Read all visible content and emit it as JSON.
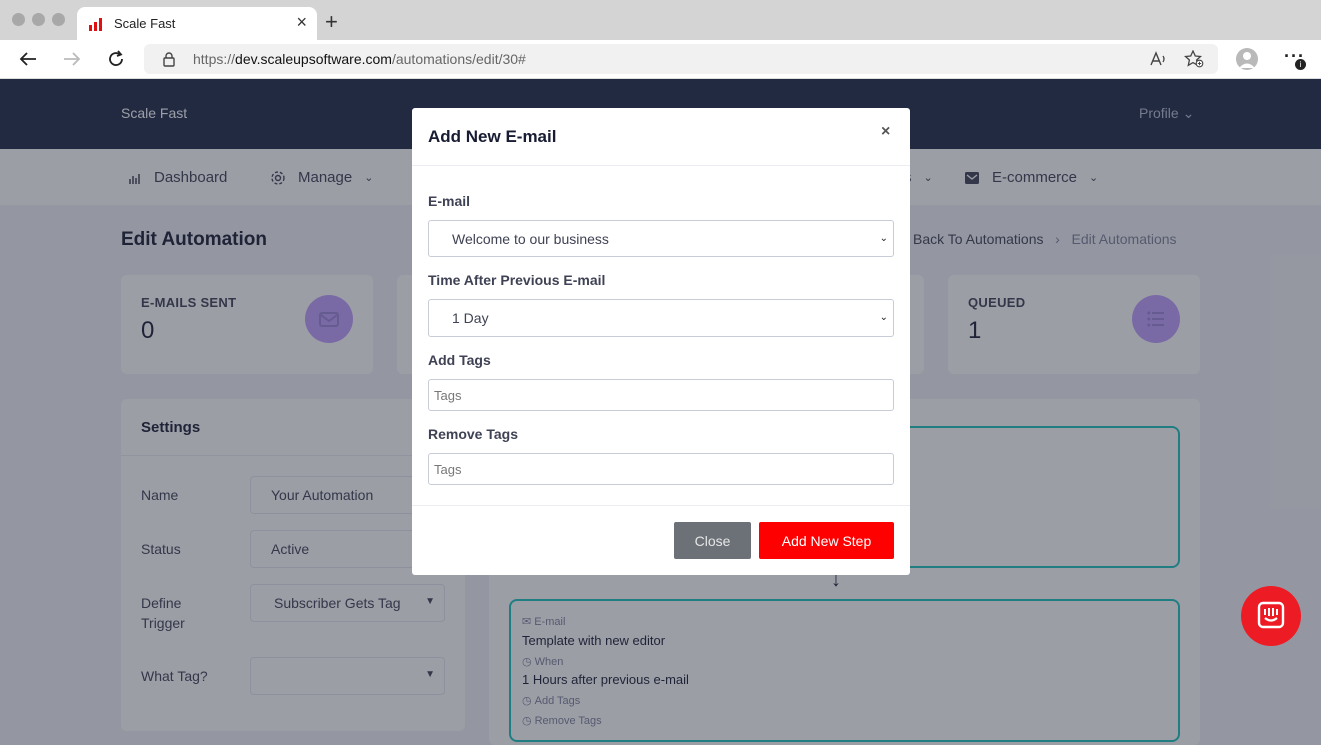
{
  "browser": {
    "tab_title": "Scale Fast",
    "tab_close": "×",
    "new_tab": "+",
    "url_scheme": "https://",
    "url_host": "dev.scaleupsoftware.com",
    "url_path": "/automations/edit/30#",
    "more": "···"
  },
  "topbar": {
    "brand": "Scale Fast",
    "profile": "Profile ⌄"
  },
  "nav": {
    "dashboard": "Dashboard",
    "manage": "Manage",
    "hidden_suffix": "s",
    "ecommerce": "E-commerce"
  },
  "page": {
    "title": "Edit Automation",
    "crumb_back": "Back To Automations",
    "crumb_sep": "›",
    "crumb_current": "Edit Automations"
  },
  "stats": {
    "sent_label": "E-MAILS SENT",
    "sent_value": "0",
    "queued_label": "QUEUED",
    "queued_value": "1"
  },
  "settings": {
    "title": "Settings",
    "name_label": "Name",
    "name_value": "Your Automation",
    "status_label": "Status",
    "status_value": "Active",
    "trigger_label": "Define Trigger",
    "trigger_value": "Subscriber Gets Tag",
    "tag_label": "What Tag?",
    "tag_value": ""
  },
  "flow": {
    "step2_type": "E-mail",
    "step2_template": "Template with new editor",
    "step2_when_label": "When",
    "step2_when": "1 Hours after previous e-mail",
    "step2_add_tags": "Add Tags",
    "step2_remove_tags": "Remove Tags"
  },
  "modal": {
    "title": "Add New E-mail",
    "close_x": "×",
    "email_label": "E-mail",
    "email_value": "Welcome to our business",
    "time_label": "Time After Previous E-mail",
    "time_value": "1 Day",
    "add_tags_label": "Add Tags",
    "add_tags_placeholder": "Tags",
    "remove_tags_label": "Remove Tags",
    "remove_tags_placeholder": "Tags",
    "close_button": "Close",
    "add_button": "Add New Step"
  },
  "colors": {
    "topbar": "#1e2a45",
    "accent_red": "#ff0000",
    "step_border": "#1bc5bd",
    "stat_icon": "#8950fc"
  },
  "icons": {
    "chat": "chat-bubble-icon",
    "lock": "lock-icon",
    "sent": "envelope-icon",
    "queued": "list-icon"
  }
}
